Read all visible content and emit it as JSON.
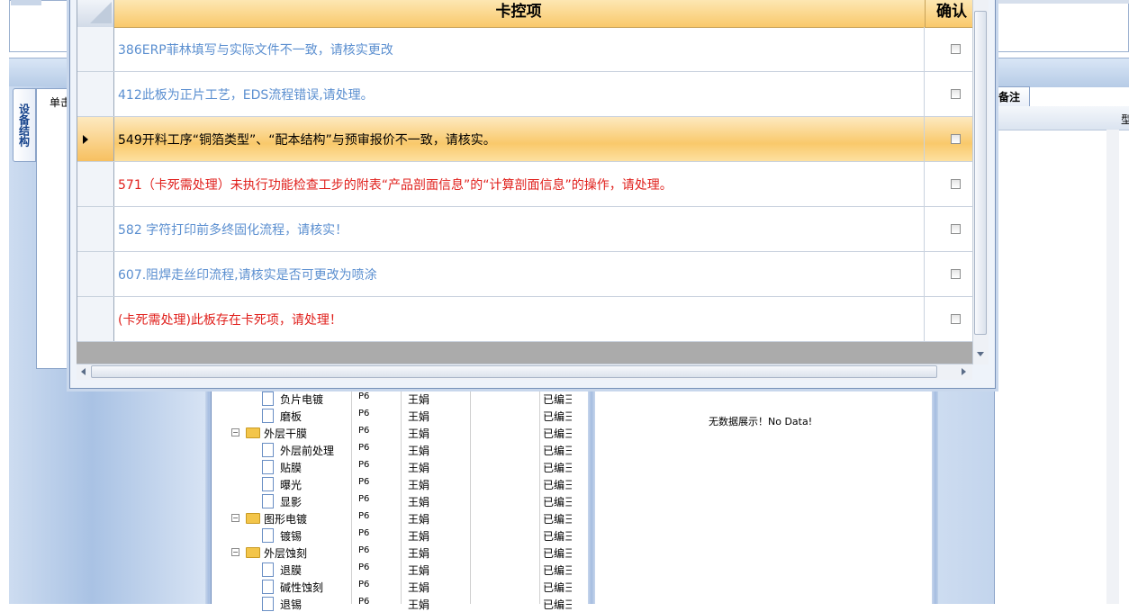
{
  "background": {
    "vertical_tab": "设备结构",
    "left_label": "单击",
    "remark_tab": "备注",
    "remark_col_partial": "型",
    "no_data": "无数据展示！No Data!",
    "tree": [
      {
        "type": "file",
        "label": "负片电镀",
        "c1": "P6",
        "c2": "王娟",
        "c3": "已编彐"
      },
      {
        "type": "file",
        "label": "磨板",
        "c1": "P6",
        "c2": "王娟",
        "c3": "已编彐"
      },
      {
        "type": "folder",
        "label": "外层干膜",
        "c1": "P6",
        "c2": "王娟",
        "c3": "已编彐"
      },
      {
        "type": "file",
        "label": "外层前处理",
        "c1": "P6",
        "c2": "王娟",
        "c3": "已编彐"
      },
      {
        "type": "file",
        "label": "贴膜",
        "c1": "P6",
        "c2": "王娟",
        "c3": "已编彐"
      },
      {
        "type": "file",
        "label": "曝光",
        "c1": "P6",
        "c2": "王娟",
        "c3": "已编彐"
      },
      {
        "type": "file",
        "label": "显影",
        "c1": "P6",
        "c2": "王娟",
        "c3": "已编彐"
      },
      {
        "type": "folder",
        "label": "图形电镀",
        "c1": "P6",
        "c2": "王娟",
        "c3": "已编彐"
      },
      {
        "type": "file",
        "label": "镀锡",
        "c1": "P6",
        "c2": "王娟",
        "c3": "已编彐"
      },
      {
        "type": "folder",
        "label": "外层蚀刻",
        "c1": "P6",
        "c2": "王娟",
        "c3": "已编彐"
      },
      {
        "type": "file",
        "label": "退膜",
        "c1": "P6",
        "c2": "王娟",
        "c3": "已编彐"
      },
      {
        "type": "file",
        "label": "碱性蚀刻",
        "c1": "P6",
        "c2": "王娟",
        "c3": "已编彐"
      },
      {
        "type": "file",
        "label": "退锡",
        "c1": "P6",
        "c2": "王娟",
        "c3": "已编彐"
      }
    ]
  },
  "dialog": {
    "header_item": "卡控项",
    "header_confirm": "确认",
    "rows": [
      {
        "text": "386ERP菲林填写与实际文件不一致，请核实更改",
        "color": "#5b8fd0",
        "checked": false
      },
      {
        "text": "412此板为正片工艺，EDS流程错误,请处理。",
        "color": "#5b8fd0",
        "checked": false
      },
      {
        "text": "549开料工序“铜箔类型”、“配本结构”与预审报价不一致，请核实。",
        "color": "#000000",
        "checked": false
      },
      {
        "text": "571（卡死需处理）未执行功能检查工步的附表“产品剖面信息”的“计算剖面信息”的操作，请处理。",
        "color": "#e0201c",
        "checked": false
      },
      {
        "text": "582 字符打印前多终固化流程，请核实！",
        "color": "#5b8fd0",
        "checked": false
      },
      {
        "text": "607.阻焊走丝印流程,请核实是否可更改为喷涂",
        "color": "#5b8fd0",
        "checked": false
      },
      {
        "text": "(卡死需处理)此板存在卡死项，请处理！",
        "color": "#e0201c",
        "checked": false
      }
    ]
  }
}
